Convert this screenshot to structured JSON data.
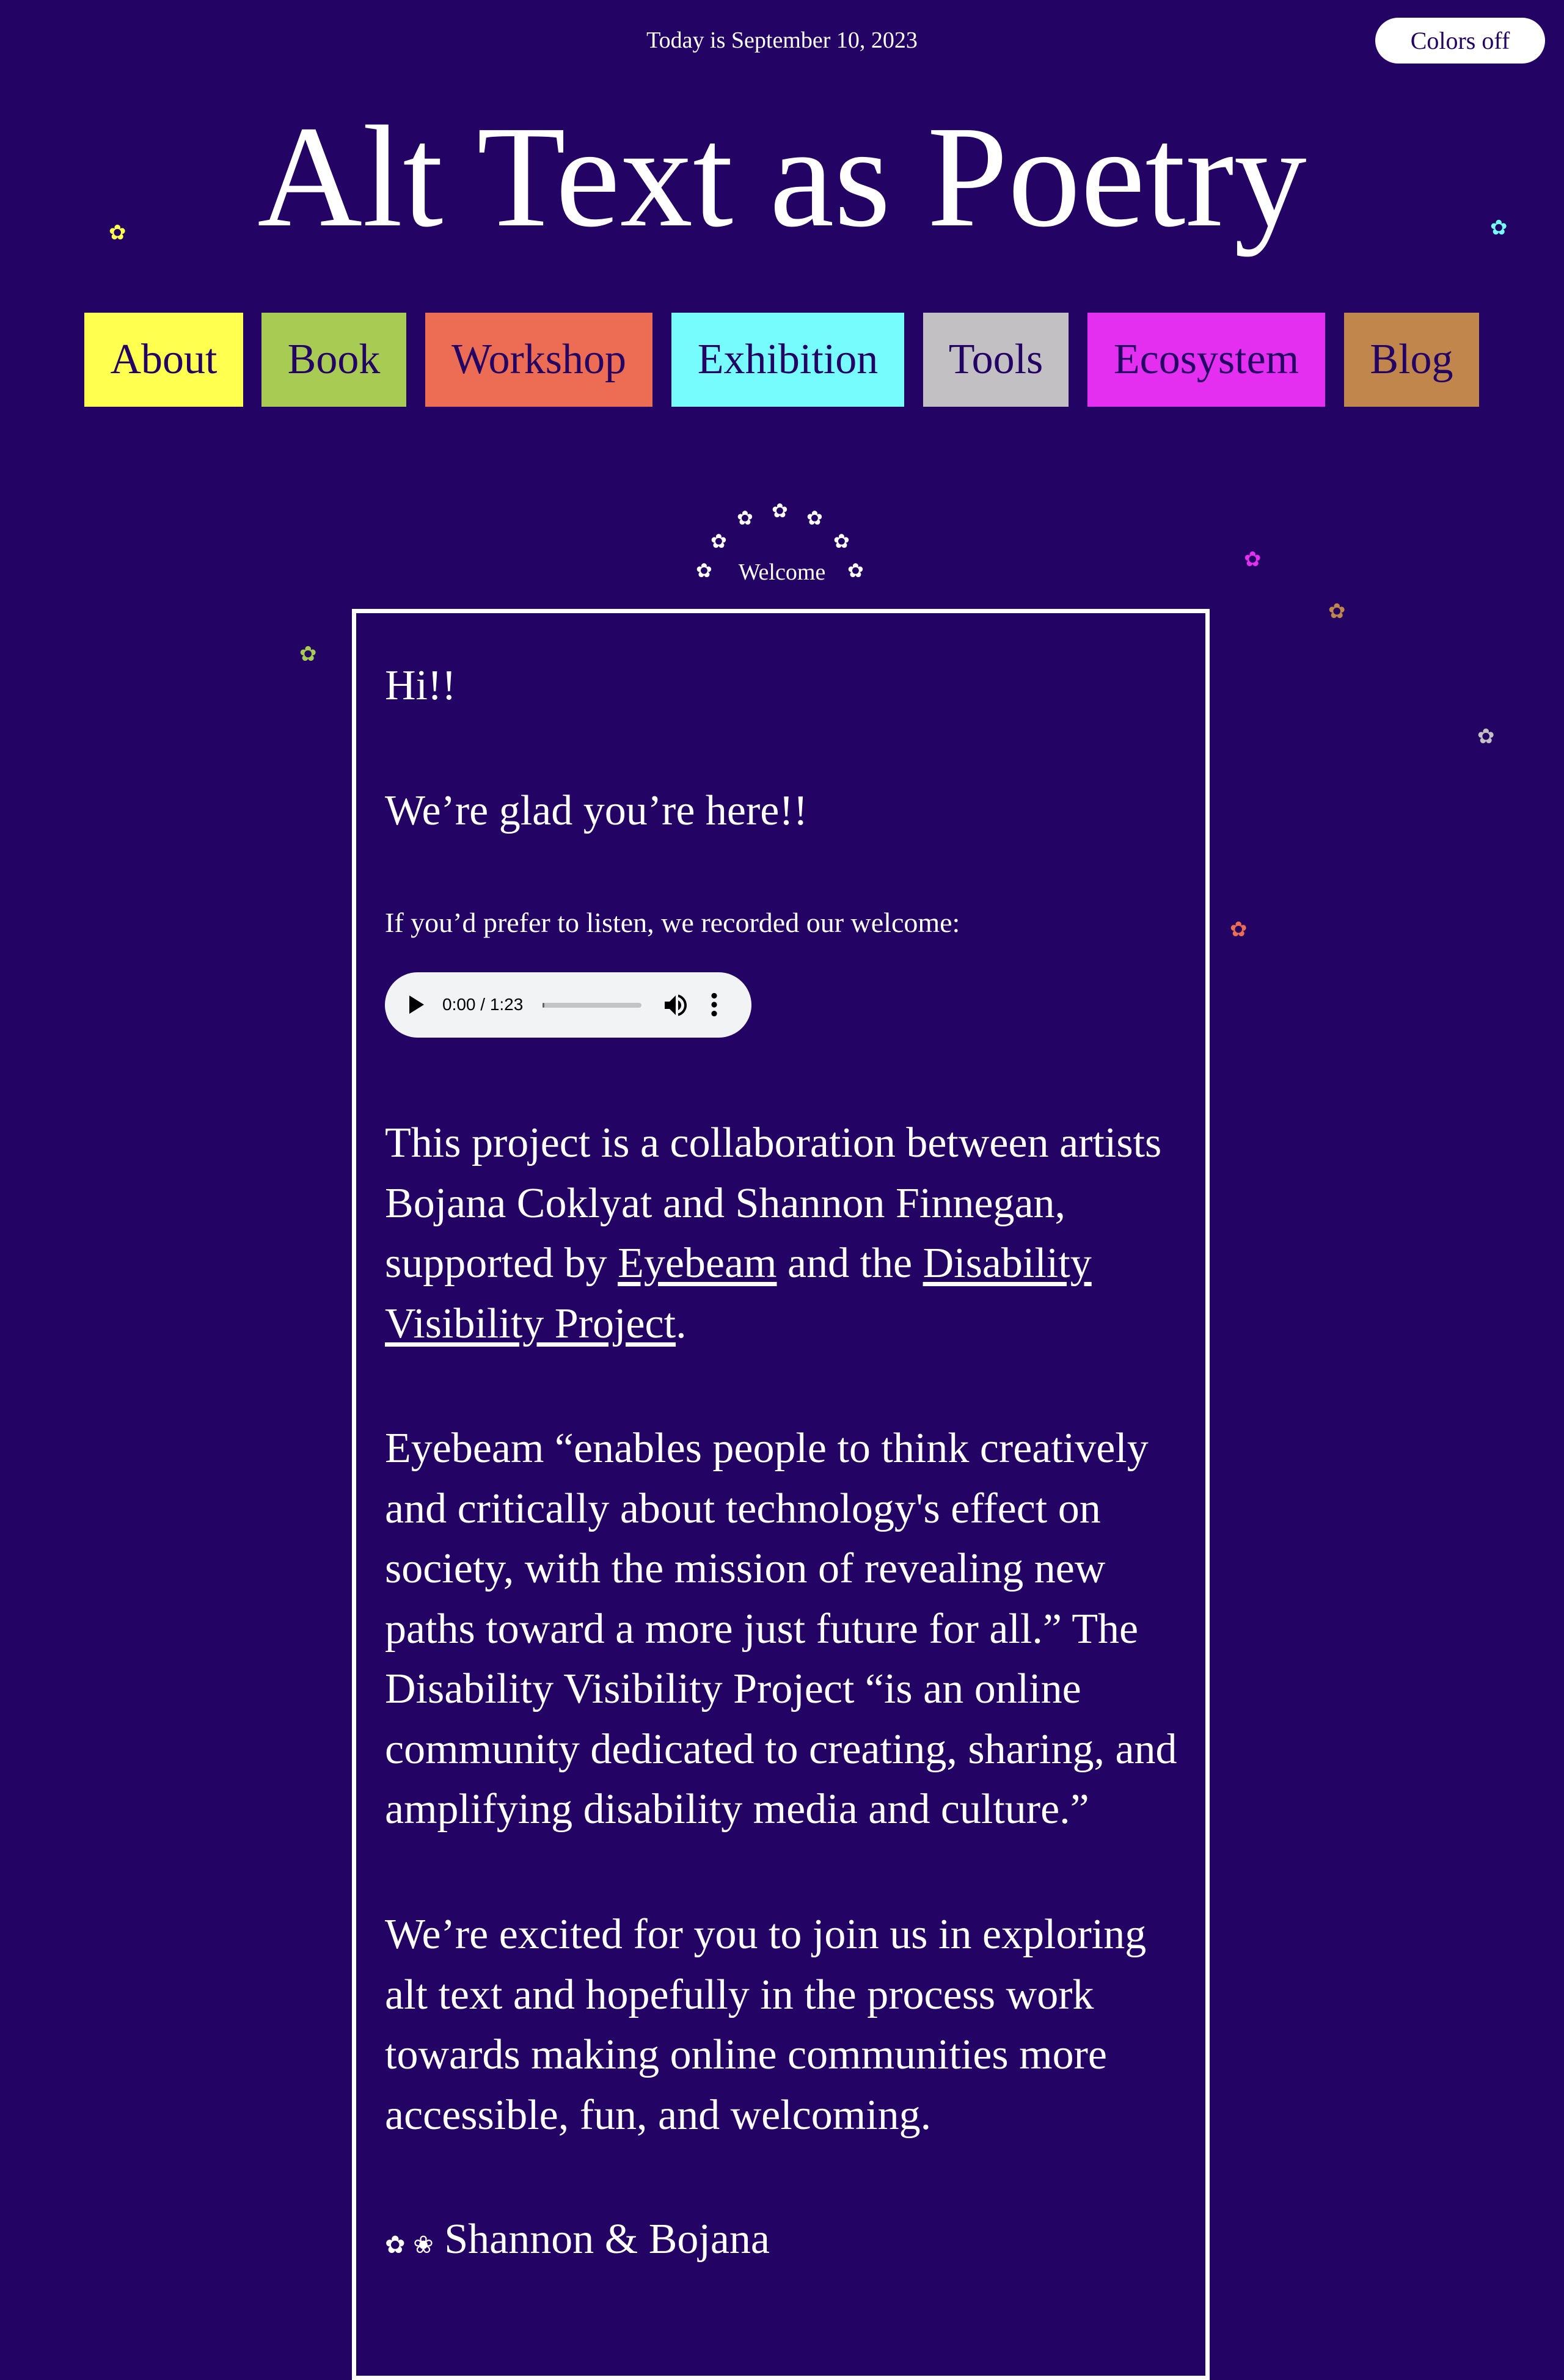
{
  "header": {
    "date_text": "Today is September 10, 2023",
    "colors_toggle_label": "Colors off",
    "site_title": "Alt Text as Poetry"
  },
  "nav": {
    "items": [
      {
        "label": "About",
        "color": "#ffff4f"
      },
      {
        "label": "Book",
        "color": "#a8cc53"
      },
      {
        "label": "Workshop",
        "color": "#ec6c54"
      },
      {
        "label": "Exhibition",
        "color": "#76fcfc"
      },
      {
        "label": "Tools",
        "color": "#c2c0c2"
      },
      {
        "label": "Ecosystem",
        "color": "#e52ff0"
      },
      {
        "label": "Blog",
        "color": "#c0864b"
      }
    ]
  },
  "decor": {
    "flower_glyph": "✿",
    "arc_flower_glyph": "✿",
    "flower_colors": {
      "yellow": "#ffff4f",
      "cyan": "#76fcfc",
      "magenta": "#e52ff0",
      "brown": "#c0864b",
      "green": "#a8cc53",
      "gray": "#c2c0c2",
      "coral": "#ec6c54"
    }
  },
  "welcome": {
    "label": "Welcome",
    "greeting": "Hi!!",
    "glad": "We’re glad you’re here!!",
    "listen_prompt": "If you’d prefer to listen, we recorded our welcome:",
    "audio": {
      "time_display": "0:00 / 1:23",
      "progress": 0.02
    },
    "collab": {
      "text_before": "This project is a collaboration between artists Bojana Coklyat and Shannon Finnegan, supported by ",
      "link_eyebeam": "Eyebeam",
      "text_middle": " and the ",
      "link_dvp": "Disability Visibility Project",
      "text_after": "."
    },
    "quote_paragraph": "Eyebeam “enables people to think creatively and critically about technology's effect on society, with the mission of revealing new paths toward a more just future for all.” The Disability Visibility Project “is an online community dedicated to creating, sharing, and amplifying disability media and culture.”",
    "excited_paragraph": "We’re excited for you to join us in exploring alt text and hopefully in the process work towards making online communities more accessible, fun, and welcoming.",
    "signoff_icons": "✿ ❀",
    "signoff_names": "Shannon & Bojana"
  }
}
